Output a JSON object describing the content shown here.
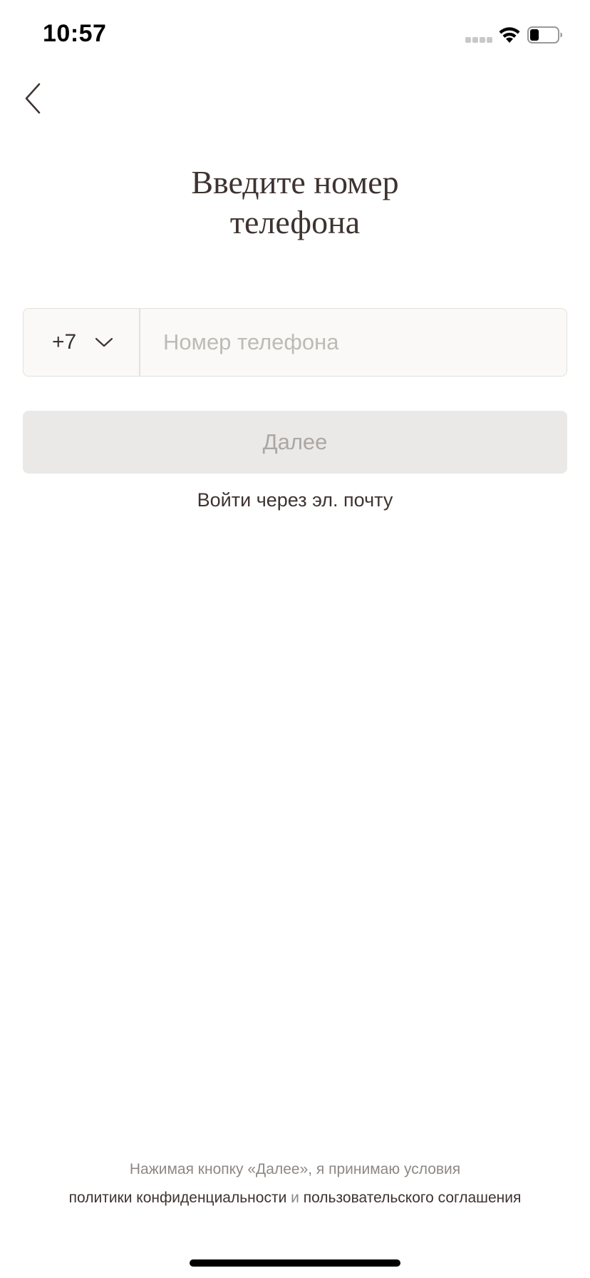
{
  "status_bar": {
    "time": "10:57"
  },
  "header": {
    "back_icon": "chevron-left-icon"
  },
  "title": {
    "line1": "Введите номер",
    "line2": "телефона"
  },
  "phone_form": {
    "country_code": "+7",
    "dropdown_icon": "chevron-down-icon",
    "phone_value": "",
    "phone_placeholder": "Номер телефона"
  },
  "next_button": {
    "label": "Далее",
    "enabled": false
  },
  "email_login": {
    "label": "Войти через эл. почту"
  },
  "terms": {
    "line1": "Нажимая кнопку «Далее», я принимаю условия",
    "privacy_link": "политики конфиденциальности",
    "conjunction": "и",
    "agreement_link": "пользовательского соглашения"
  },
  "colors": {
    "text_primary": "#3e3330",
    "text_muted": "#8e8884",
    "field_bg": "#faf9f8",
    "field_border": "#e5e1dc",
    "button_disabled_bg": "#ebe9e7",
    "button_disabled_text": "#aca7a2"
  }
}
